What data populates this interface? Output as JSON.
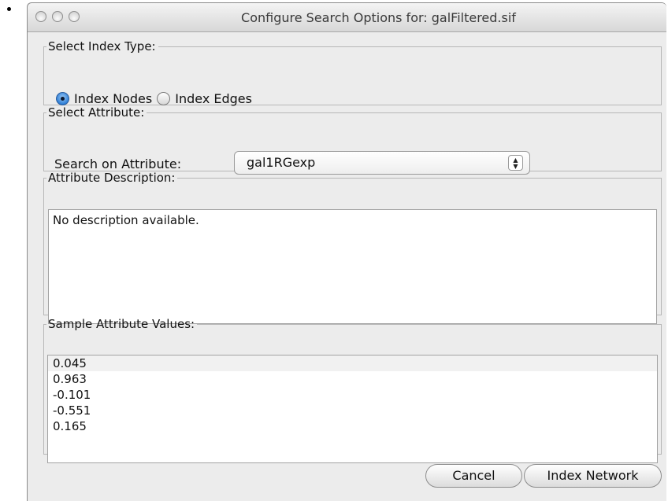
{
  "window": {
    "title": "Configure Search Options for:  galFiltered.sif"
  },
  "index_type": {
    "legend": "Select Index Type:",
    "options": [
      "Index Nodes",
      "Index Edges"
    ],
    "selected": "Index Nodes"
  },
  "attribute": {
    "legend": "Select Attribute:",
    "search_label": "Search on Attribute:",
    "selected": "gal1RGexp"
  },
  "description": {
    "legend": "Attribute Description:",
    "text": "No description available."
  },
  "samples": {
    "legend": "Sample Attribute Values:",
    "values": [
      "0.045",
      "0.963",
      "-0.101",
      "-0.551",
      "0.165"
    ]
  },
  "buttons": {
    "cancel": "Cancel",
    "index": "Index Network"
  }
}
